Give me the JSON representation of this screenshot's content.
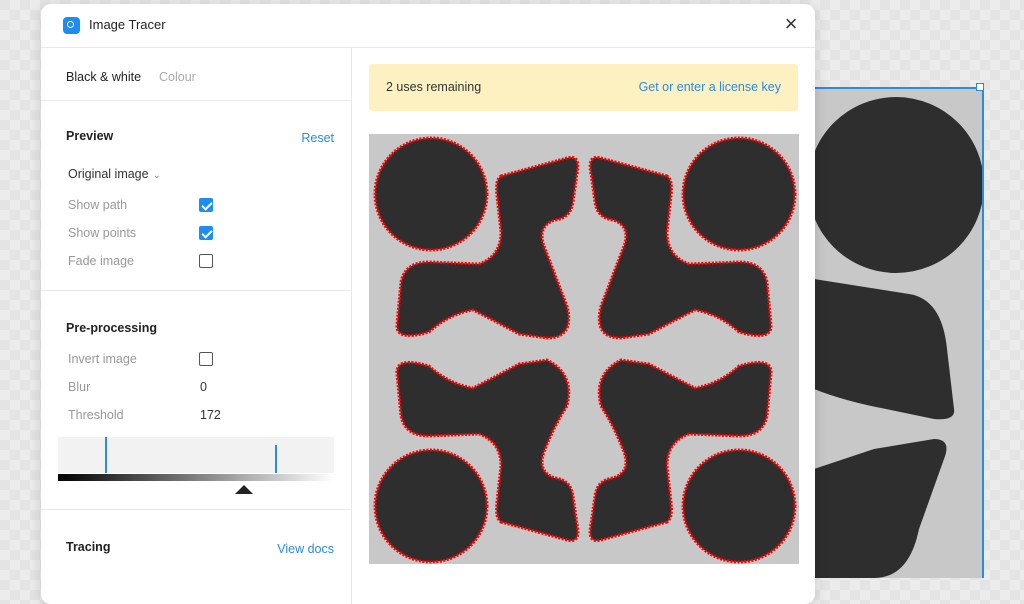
{
  "dialog": {
    "title": "Image Tracer",
    "close_icon": "close-icon"
  },
  "tabs": [
    "Black & white",
    "Colour"
  ],
  "preview": {
    "title": "Preview",
    "reset": "Reset",
    "dropdown": "Original image",
    "options": [
      {
        "label": "Show path",
        "checked": true
      },
      {
        "label": "Show points",
        "checked": true
      },
      {
        "label": "Fade image",
        "checked": false
      }
    ]
  },
  "preprocessing": {
    "title": "Pre-processing",
    "invert_label": "Invert image",
    "invert_checked": false,
    "blur_label": "Blur",
    "blur_value": "0",
    "threshold_label": "Threshold",
    "threshold_value": "172"
  },
  "tracing": {
    "title": "Tracing",
    "docs_link": "View docs"
  },
  "banner": {
    "text": "2 uses remaining",
    "link": "Get or enter a license key"
  },
  "colors": {
    "accent": "#2b8ae2",
    "shape": "#2e2e2e",
    "path": "#ff0000",
    "banner_bg": "#fdf1c2"
  }
}
